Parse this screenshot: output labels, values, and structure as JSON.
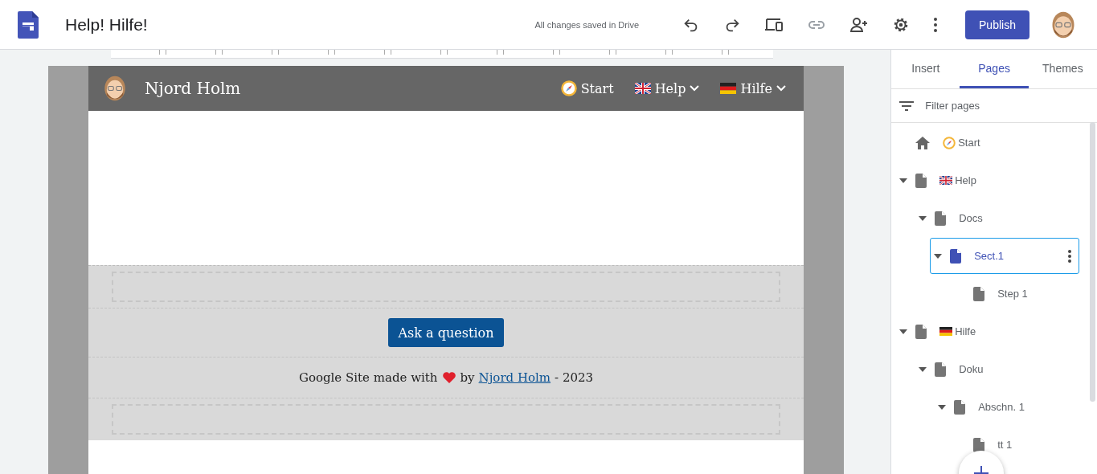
{
  "app": {
    "title": "Help! Hilfe!",
    "save_status": "All changes saved in Drive",
    "publish": "Publish"
  },
  "site": {
    "name": "Njord Holm",
    "nav": [
      {
        "label": "Start",
        "dropdown": false
      },
      {
        "label": "Help",
        "dropdown": true
      },
      {
        "label": "Hilfe",
        "dropdown": true
      }
    ],
    "button": "Ask a question",
    "footer": {
      "before": "Google Site made with",
      "after_heart": "by",
      "link": "Njord Holm",
      "after": "- 2023"
    }
  },
  "panel": {
    "tabs": [
      {
        "label": "Insert",
        "selected": false
      },
      {
        "label": "Pages",
        "selected": true
      },
      {
        "label": "Themes",
        "selected": false
      }
    ],
    "filter": {
      "placeholder": "Filter pages"
    },
    "pages": [
      {
        "label": "Start",
        "kind": "home",
        "selected": false
      },
      {
        "label": "Help",
        "kind": "page",
        "expanded": true,
        "selected": false,
        "children": [
          {
            "label": "Docs",
            "kind": "page",
            "expanded": true,
            "selected": false,
            "children": [
              {
                "label": "Sect.1",
                "kind": "page",
                "expanded": true,
                "selected": true,
                "children": [
                  {
                    "label": "Step 1",
                    "kind": "page",
                    "selected": false
                  }
                ]
              }
            ]
          }
        ]
      },
      {
        "label": "Hilfe",
        "kind": "page",
        "expanded": true,
        "selected": false,
        "children": [
          {
            "label": "Doku",
            "kind": "page",
            "expanded": true,
            "selected": false,
            "children": [
              {
                "label": "Abschn. 1",
                "kind": "page",
                "expanded": true,
                "selected": false,
                "children": [
                  {
                    "label": "tt 1",
                    "kind": "page",
                    "selected": false
                  }
                ]
              }
            ]
          }
        ]
      }
    ]
  }
}
